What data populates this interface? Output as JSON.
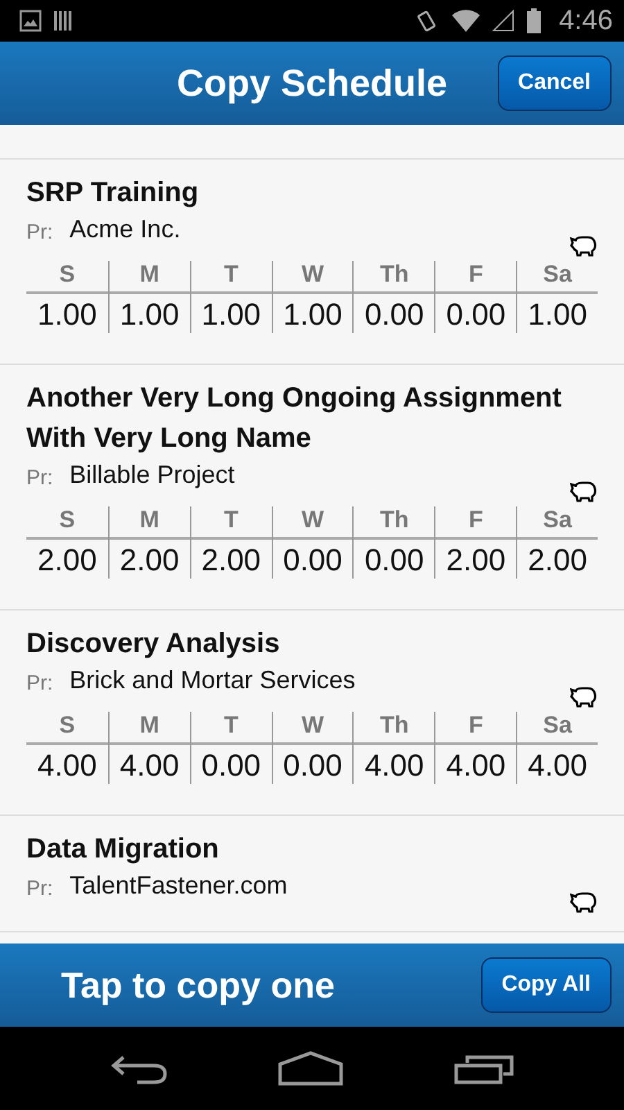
{
  "status_bar": {
    "time": "4:46"
  },
  "header": {
    "title": "Copy Schedule",
    "cancel": "Cancel"
  },
  "assignments": [
    {
      "name": "SRP Training",
      "project_label": "Pr:",
      "project": "Acme Inc.",
      "days": [
        "S",
        "M",
        "T",
        "W",
        "Th",
        "F",
        "Sa"
      ],
      "hours": [
        "1.00",
        "1.00",
        "1.00",
        "1.00",
        "0.00",
        "0.00",
        "1.00"
      ]
    },
    {
      "name": "Another Very Long Ongoing Assignment With Very Long Name",
      "project_label": "Pr:",
      "project": "Billable Project",
      "days": [
        "S",
        "M",
        "T",
        "W",
        "Th",
        "F",
        "Sa"
      ],
      "hours": [
        "2.00",
        "2.00",
        "2.00",
        "0.00",
        "0.00",
        "2.00",
        "2.00"
      ]
    },
    {
      "name": "Discovery Analysis",
      "project_label": "Pr:",
      "project": "Brick and Mortar Services",
      "days": [
        "S",
        "M",
        "T",
        "W",
        "Th",
        "F",
        "Sa"
      ],
      "hours": [
        "4.00",
        "4.00",
        "0.00",
        "0.00",
        "4.00",
        "4.00",
        "4.00"
      ]
    },
    {
      "name": "Data Migration",
      "project_label": "Pr:",
      "project": "TalentFastener.com"
    }
  ],
  "footer": {
    "hint": "Tap to copy one",
    "copy_all": "Copy All"
  }
}
